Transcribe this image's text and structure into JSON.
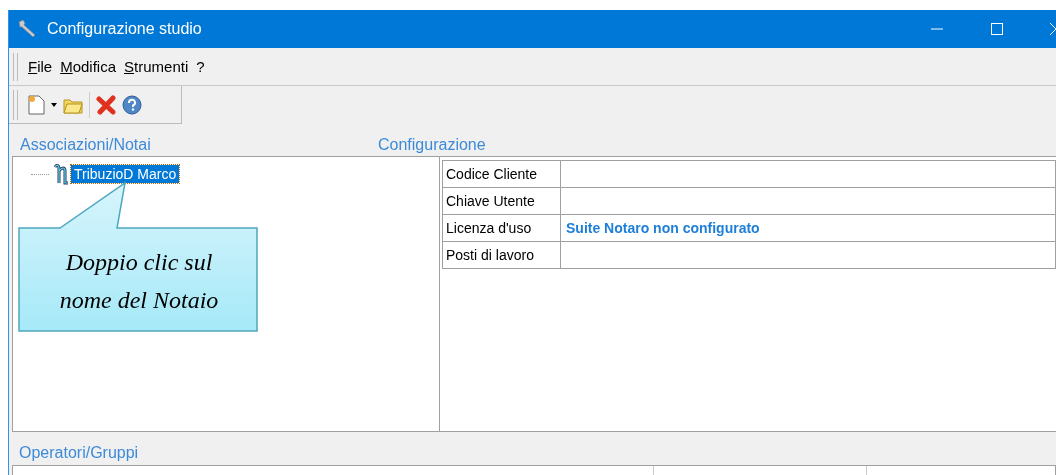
{
  "window": {
    "title": "Configurazione studio"
  },
  "menu": [
    {
      "label": "File"
    },
    {
      "label": "Modifica"
    },
    {
      "label": "Strumenti"
    },
    {
      "label": "?"
    }
  ],
  "sections": {
    "left": "Associazioni/Notai",
    "right": "Configurazione",
    "bottom": "Operatori/Gruppi"
  },
  "tree": {
    "items": [
      {
        "label": "TribuzioD Marco",
        "selected": true
      }
    ]
  },
  "properties": [
    {
      "label": "Codice Cliente"
    },
    {
      "label": "Chiave Utente"
    },
    {
      "label": "Licenza d'uso",
      "value": "Suite Notaro non configurato"
    },
    {
      "label": "Posti di lavoro"
    }
  ],
  "callout": {
    "text": "Doppio clic sul\nnome del Notaio"
  }
}
